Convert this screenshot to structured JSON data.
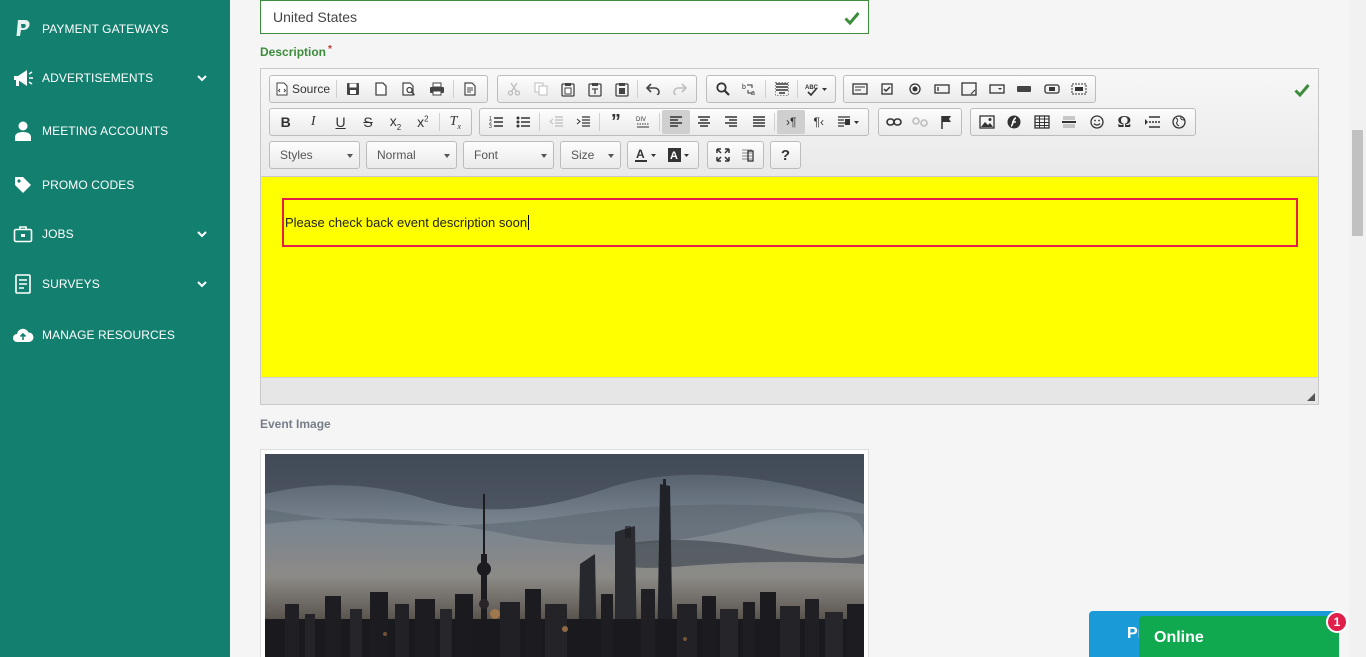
{
  "sidebar": {
    "items": [
      {
        "label": "PAYMENT GATEWAYS",
        "icon": "paypal-icon"
      },
      {
        "label": "ADVERTISEMENTS",
        "icon": "megaphone-icon",
        "expandable": true
      },
      {
        "label": "MEETING ACCOUNTS",
        "icon": "user-icon"
      },
      {
        "label": "PROMO CODES",
        "icon": "tag-icon"
      },
      {
        "label": "JOBS",
        "icon": "briefcase-icon",
        "expandable": true
      },
      {
        "label": "SURVEYS",
        "icon": "survey-icon",
        "expandable": true
      },
      {
        "label": "MANAGE RESOURCES",
        "icon": "cloud-upload-icon"
      }
    ],
    "background": "#13806f"
  },
  "form": {
    "country_value": "United States",
    "description_label": "Description",
    "required_mark": "*",
    "event_image_label": "Event Image"
  },
  "editor": {
    "source_label": "Source",
    "styles_label": "Styles",
    "format_label": "Normal",
    "font_label": "Font",
    "size_label": "Size",
    "help_label": "?",
    "content_text": "Please check back event description soon",
    "content_background": "#ffff00",
    "content_border": "#e0204a"
  },
  "chat": {
    "blue_label": "Pr",
    "online_label": "Online",
    "badge_count": "1"
  },
  "colors": {
    "valid": "#3c8c3c",
    "blue_widget": "#1a9bd7",
    "green_widget": "#10a94f"
  }
}
